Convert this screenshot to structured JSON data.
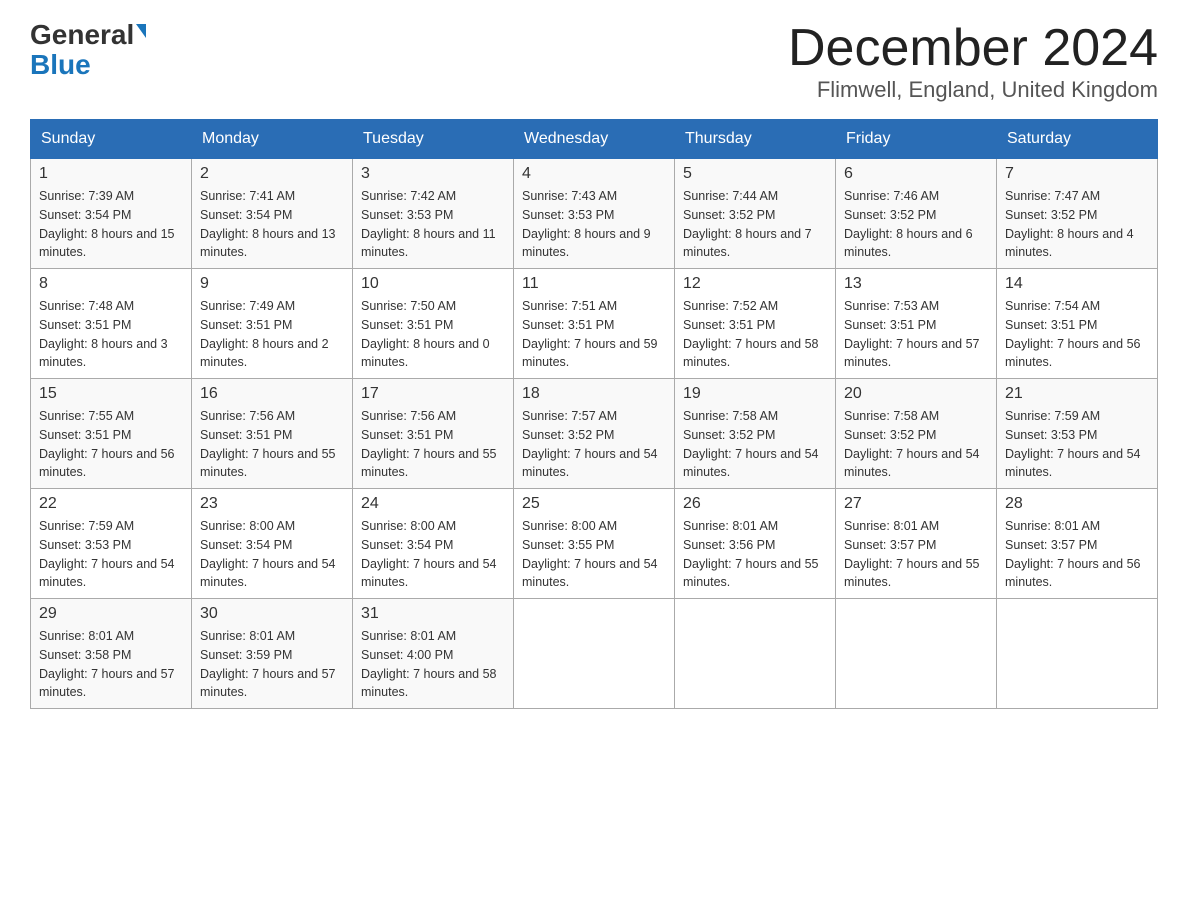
{
  "header": {
    "logo_line1": "General",
    "logo_line2": "Blue",
    "month_title": "December 2024",
    "location": "Flimwell, England, United Kingdom"
  },
  "days_of_week": [
    "Sunday",
    "Monday",
    "Tuesday",
    "Wednesday",
    "Thursday",
    "Friday",
    "Saturday"
  ],
  "weeks": [
    [
      {
        "day": "1",
        "sunrise": "7:39 AM",
        "sunset": "3:54 PM",
        "daylight": "8 hours and 15 minutes."
      },
      {
        "day": "2",
        "sunrise": "7:41 AM",
        "sunset": "3:54 PM",
        "daylight": "8 hours and 13 minutes."
      },
      {
        "day": "3",
        "sunrise": "7:42 AM",
        "sunset": "3:53 PM",
        "daylight": "8 hours and 11 minutes."
      },
      {
        "day": "4",
        "sunrise": "7:43 AM",
        "sunset": "3:53 PM",
        "daylight": "8 hours and 9 minutes."
      },
      {
        "day": "5",
        "sunrise": "7:44 AM",
        "sunset": "3:52 PM",
        "daylight": "8 hours and 7 minutes."
      },
      {
        "day": "6",
        "sunrise": "7:46 AM",
        "sunset": "3:52 PM",
        "daylight": "8 hours and 6 minutes."
      },
      {
        "day": "7",
        "sunrise": "7:47 AM",
        "sunset": "3:52 PM",
        "daylight": "8 hours and 4 minutes."
      }
    ],
    [
      {
        "day": "8",
        "sunrise": "7:48 AM",
        "sunset": "3:51 PM",
        "daylight": "8 hours and 3 minutes."
      },
      {
        "day": "9",
        "sunrise": "7:49 AM",
        "sunset": "3:51 PM",
        "daylight": "8 hours and 2 minutes."
      },
      {
        "day": "10",
        "sunrise": "7:50 AM",
        "sunset": "3:51 PM",
        "daylight": "8 hours and 0 minutes."
      },
      {
        "day": "11",
        "sunrise": "7:51 AM",
        "sunset": "3:51 PM",
        "daylight": "7 hours and 59 minutes."
      },
      {
        "day": "12",
        "sunrise": "7:52 AM",
        "sunset": "3:51 PM",
        "daylight": "7 hours and 58 minutes."
      },
      {
        "day": "13",
        "sunrise": "7:53 AM",
        "sunset": "3:51 PM",
        "daylight": "7 hours and 57 minutes."
      },
      {
        "day": "14",
        "sunrise": "7:54 AM",
        "sunset": "3:51 PM",
        "daylight": "7 hours and 56 minutes."
      }
    ],
    [
      {
        "day": "15",
        "sunrise": "7:55 AM",
        "sunset": "3:51 PM",
        "daylight": "7 hours and 56 minutes."
      },
      {
        "day": "16",
        "sunrise": "7:56 AM",
        "sunset": "3:51 PM",
        "daylight": "7 hours and 55 minutes."
      },
      {
        "day": "17",
        "sunrise": "7:56 AM",
        "sunset": "3:51 PM",
        "daylight": "7 hours and 55 minutes."
      },
      {
        "day": "18",
        "sunrise": "7:57 AM",
        "sunset": "3:52 PM",
        "daylight": "7 hours and 54 minutes."
      },
      {
        "day": "19",
        "sunrise": "7:58 AM",
        "sunset": "3:52 PM",
        "daylight": "7 hours and 54 minutes."
      },
      {
        "day": "20",
        "sunrise": "7:58 AM",
        "sunset": "3:52 PM",
        "daylight": "7 hours and 54 minutes."
      },
      {
        "day": "21",
        "sunrise": "7:59 AM",
        "sunset": "3:53 PM",
        "daylight": "7 hours and 54 minutes."
      }
    ],
    [
      {
        "day": "22",
        "sunrise": "7:59 AM",
        "sunset": "3:53 PM",
        "daylight": "7 hours and 54 minutes."
      },
      {
        "day": "23",
        "sunrise": "8:00 AM",
        "sunset": "3:54 PM",
        "daylight": "7 hours and 54 minutes."
      },
      {
        "day": "24",
        "sunrise": "8:00 AM",
        "sunset": "3:54 PM",
        "daylight": "7 hours and 54 minutes."
      },
      {
        "day": "25",
        "sunrise": "8:00 AM",
        "sunset": "3:55 PM",
        "daylight": "7 hours and 54 minutes."
      },
      {
        "day": "26",
        "sunrise": "8:01 AM",
        "sunset": "3:56 PM",
        "daylight": "7 hours and 55 minutes."
      },
      {
        "day": "27",
        "sunrise": "8:01 AM",
        "sunset": "3:57 PM",
        "daylight": "7 hours and 55 minutes."
      },
      {
        "day": "28",
        "sunrise": "8:01 AM",
        "sunset": "3:57 PM",
        "daylight": "7 hours and 56 minutes."
      }
    ],
    [
      {
        "day": "29",
        "sunrise": "8:01 AM",
        "sunset": "3:58 PM",
        "daylight": "7 hours and 57 minutes."
      },
      {
        "day": "30",
        "sunrise": "8:01 AM",
        "sunset": "3:59 PM",
        "daylight": "7 hours and 57 minutes."
      },
      {
        "day": "31",
        "sunrise": "8:01 AM",
        "sunset": "4:00 PM",
        "daylight": "7 hours and 58 minutes."
      },
      null,
      null,
      null,
      null
    ]
  ]
}
